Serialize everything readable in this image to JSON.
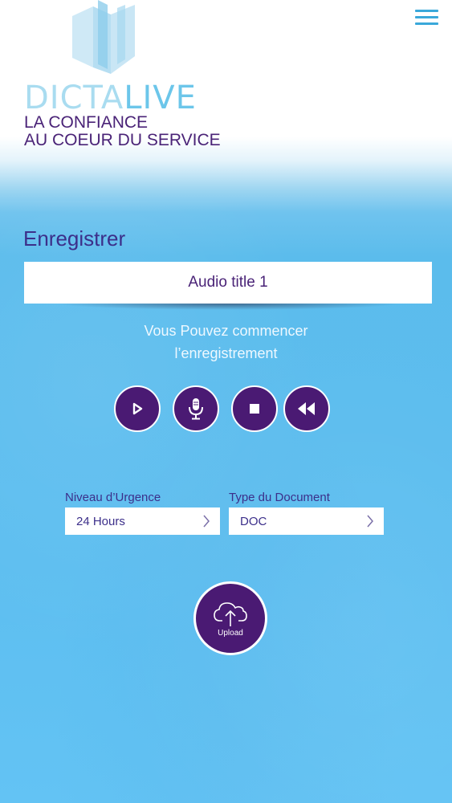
{
  "header": {
    "brand_part1": "DICTA",
    "brand_part2": "LIVE",
    "tagline_line1": "LA CONFIANCE",
    "tagline_line2": "AU COEUR DU SERVICE",
    "menu_icon": "hamburger-menu-icon"
  },
  "recorder": {
    "section_title": "Enregistrer",
    "audio_title_value": "Audio title 1",
    "hint_line1": "Vous Pouvez commencer",
    "hint_line2": "l’enregistrement",
    "controls": [
      {
        "name": "play",
        "icon": "play-icon"
      },
      {
        "name": "record",
        "icon": "microphone-icon"
      },
      {
        "name": "stop",
        "icon": "stop-icon"
      },
      {
        "name": "rewind",
        "icon": "rewind-icon"
      }
    ]
  },
  "options": {
    "urgency_label": "Niveau d’Urgence",
    "urgency_value": "24 Hours",
    "doc_type_label": "Type du Document",
    "doc_type_value": "DOC"
  },
  "upload": {
    "label": "Upload",
    "icon": "cloud-upload-icon"
  },
  "colors": {
    "accent_purple": "#4a1a73",
    "brand_light": "#a9dcf0",
    "brand_dark": "#6cc6ea",
    "background_blue": "#5dbef0",
    "text_purple": "#3c2f8a"
  }
}
